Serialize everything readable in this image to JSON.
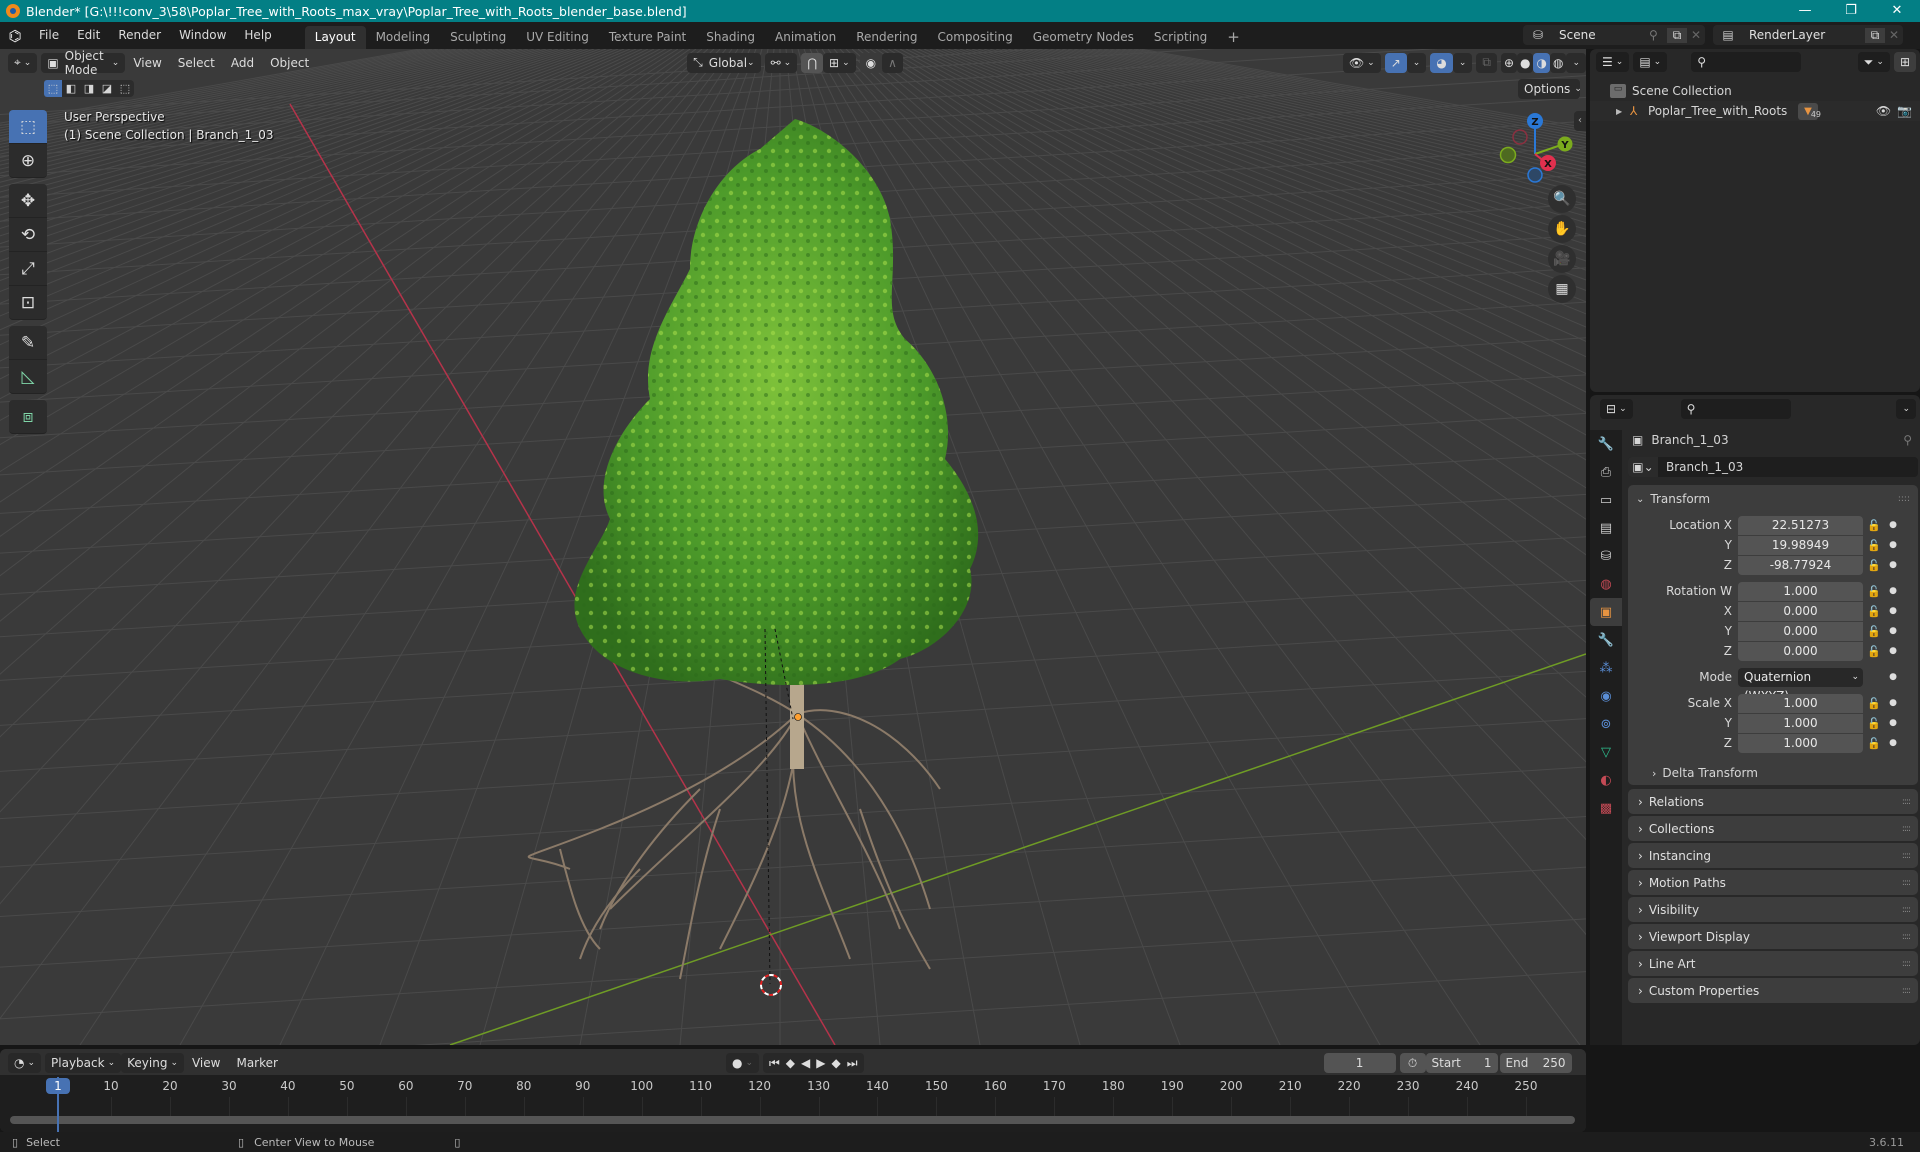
{
  "window": {
    "title": "Blender* [G:\\!!!conv_3\\58\\Poplar_Tree_with_Roots_max_vray\\Poplar_Tree_with_Roots_blender_base.blend]",
    "controls": [
      "—",
      "❐",
      "✕"
    ]
  },
  "menubar": {
    "menus": [
      "File",
      "Edit",
      "Render",
      "Window",
      "Help"
    ],
    "workspaces": [
      "Layout",
      "Modeling",
      "Sculpting",
      "UV Editing",
      "Texture Paint",
      "Shading",
      "Animation",
      "Rendering",
      "Compositing",
      "Geometry Nodes",
      "Scripting"
    ],
    "active_workspace": "Layout",
    "add_workspace": "+",
    "scene": "Scene",
    "view_layer": "RenderLayer"
  },
  "viewport": {
    "mode": "Object Mode",
    "menus": [
      "View",
      "Select",
      "Add",
      "Object"
    ],
    "orientation": "Global",
    "options_label": "Options",
    "overlay_line1": "User Perspective",
    "overlay_line2": "(1) Scene Collection | Branch_1_03",
    "gizmo": {
      "x": "X",
      "y": "Y",
      "z": "Z"
    },
    "colors": {
      "x_axis": "#e0304e",
      "y_axis": "#7bab1d",
      "z_axis": "#2a78d6",
      "active": "#4772b3",
      "grid_bg": "#3a3a3a"
    }
  },
  "outliner": {
    "root": "Scene Collection",
    "items": [
      {
        "name": "Poplar_Tree_with_Roots",
        "badge": "49"
      }
    ]
  },
  "properties": {
    "object_name": "Branch_1_03",
    "data_name": "Branch_1_03",
    "transform": {
      "title": "Transform",
      "location": {
        "label": "Location X",
        "x": "22.51273",
        "y": "19.98949",
        "z": "-98.77924"
      },
      "rotation": {
        "label": "Rotation W",
        "w": "1.000",
        "x": "0.000",
        "y": "0.000",
        "z": "0.000"
      },
      "mode_label": "Mode",
      "mode": "Quaternion (WXYZ)",
      "scale": {
        "label": "Scale X",
        "x": "1.000",
        "y": "1.000",
        "z": "1.000"
      },
      "axis_y": "Y",
      "axis_z": "Z",
      "axis_x": "X",
      "delta": "Delta Transform"
    },
    "panels": [
      "Relations",
      "Collections",
      "Instancing",
      "Motion Paths",
      "Visibility",
      "Viewport Display",
      "Line Art",
      "Custom Properties"
    ]
  },
  "timeline": {
    "menus": [
      "Playback",
      "Keying",
      "View",
      "Marker"
    ],
    "current_frame": "1",
    "start_label": "Start",
    "start": "1",
    "end_label": "End",
    "end": "250",
    "ticks": [
      "10",
      "20",
      "30",
      "40",
      "50",
      "60",
      "70",
      "80",
      "90",
      "100",
      "110",
      "120",
      "130",
      "140",
      "150",
      "160",
      "170",
      "180",
      "190",
      "200",
      "210",
      "220",
      "230",
      "240",
      "250"
    ],
    "playhead": "1"
  },
  "statusbar": {
    "select": "Select",
    "center_view": "Center View to Mouse",
    "version": "3.6.11"
  }
}
